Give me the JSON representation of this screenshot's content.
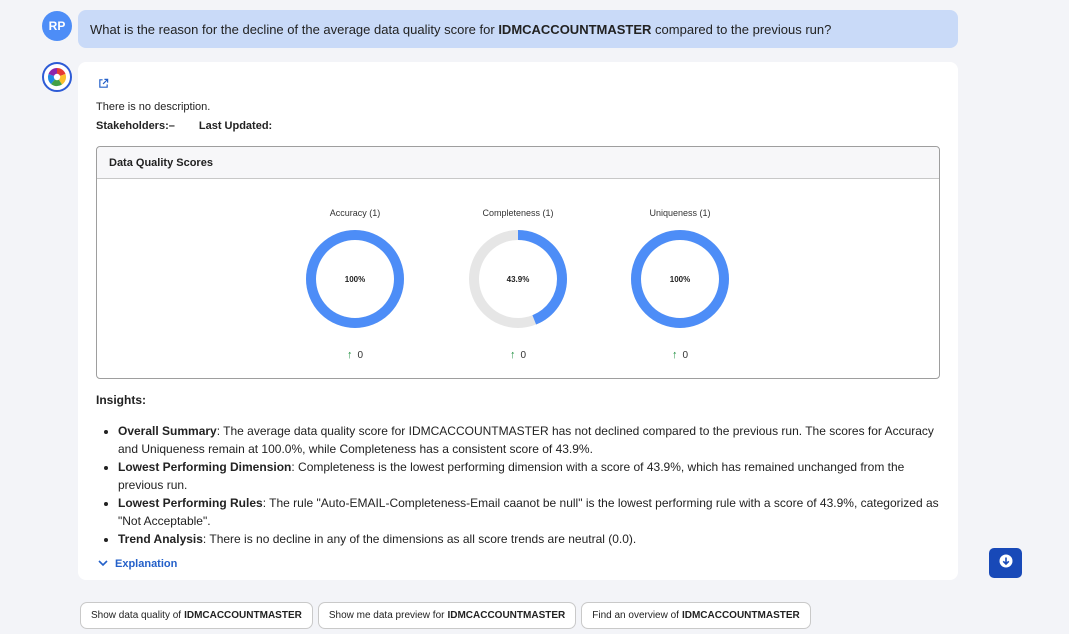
{
  "user": {
    "initials": "RP"
  },
  "question": {
    "prefix": "What is the reason for the decline of the average data quality score for",
    "asset": "IDMCACCOUNTMASTER",
    "suffix": "compared to the previous run?"
  },
  "answer": {
    "description": "There is no description.",
    "stakeholders_label": "Stakeholders:",
    "stakeholders_value": "–",
    "last_updated_label": "Last Updated:",
    "panel_title": "Data Quality Scores",
    "gauges": [
      {
        "label": "Accuracy (1)",
        "value_text": "100%",
        "value": 100,
        "trend": "0"
      },
      {
        "label": "Completeness (1)",
        "value_text": "43.9%",
        "value": 43.9,
        "trend": "0"
      },
      {
        "label": "Uniqueness (1)",
        "value_text": "100%",
        "value": 100,
        "trend": "0"
      }
    ],
    "insights_title": "Insights:",
    "insights": [
      {
        "heading": "Overall Summary",
        "text": ": The average data quality score for IDMCACCOUNTMASTER has not declined compared to the previous run. The scores for Accuracy and Uniqueness remain at 100.0%, while Completeness has a consistent score of 43.9%."
      },
      {
        "heading": "Lowest Performing Dimension",
        "text": ": Completeness is the lowest performing dimension with a score of 43.9%, which has remained unchanged from the previous run."
      },
      {
        "heading": "Lowest Performing Rules",
        "text": ": The rule \"Auto-EMAIL-Completeness-Email caanot be null\" is the lowest performing rule with a score of 43.9%, categorized as \"Not Acceptable\"."
      },
      {
        "heading": "Trend Analysis",
        "text": ": There is no decline in any of the dimensions as all score trends are neutral (0.0)."
      }
    ],
    "explanation_label": "Explanation"
  },
  "suggestions": [
    {
      "prefix": "Show data quality of",
      "asset": "IDMCACCOUNTMASTER"
    },
    {
      "prefix": "Show me data preview for",
      "asset": "IDMCACCOUNTMASTER"
    },
    {
      "prefix": "Find an overview of",
      "asset": "IDMCACCOUNTMASTER"
    }
  ],
  "colors": {
    "gauge_fill": "#4d8df7",
    "gauge_track": "#e6e6e6",
    "trend_up": "#1e8e3e",
    "link": "#2460c9",
    "user_bubble": "#c9daf8"
  },
  "icons": [
    "external-link-icon",
    "ai-assistant-icon",
    "arrow-up-icon",
    "chevron-down-icon",
    "scroll-down-icon"
  ]
}
